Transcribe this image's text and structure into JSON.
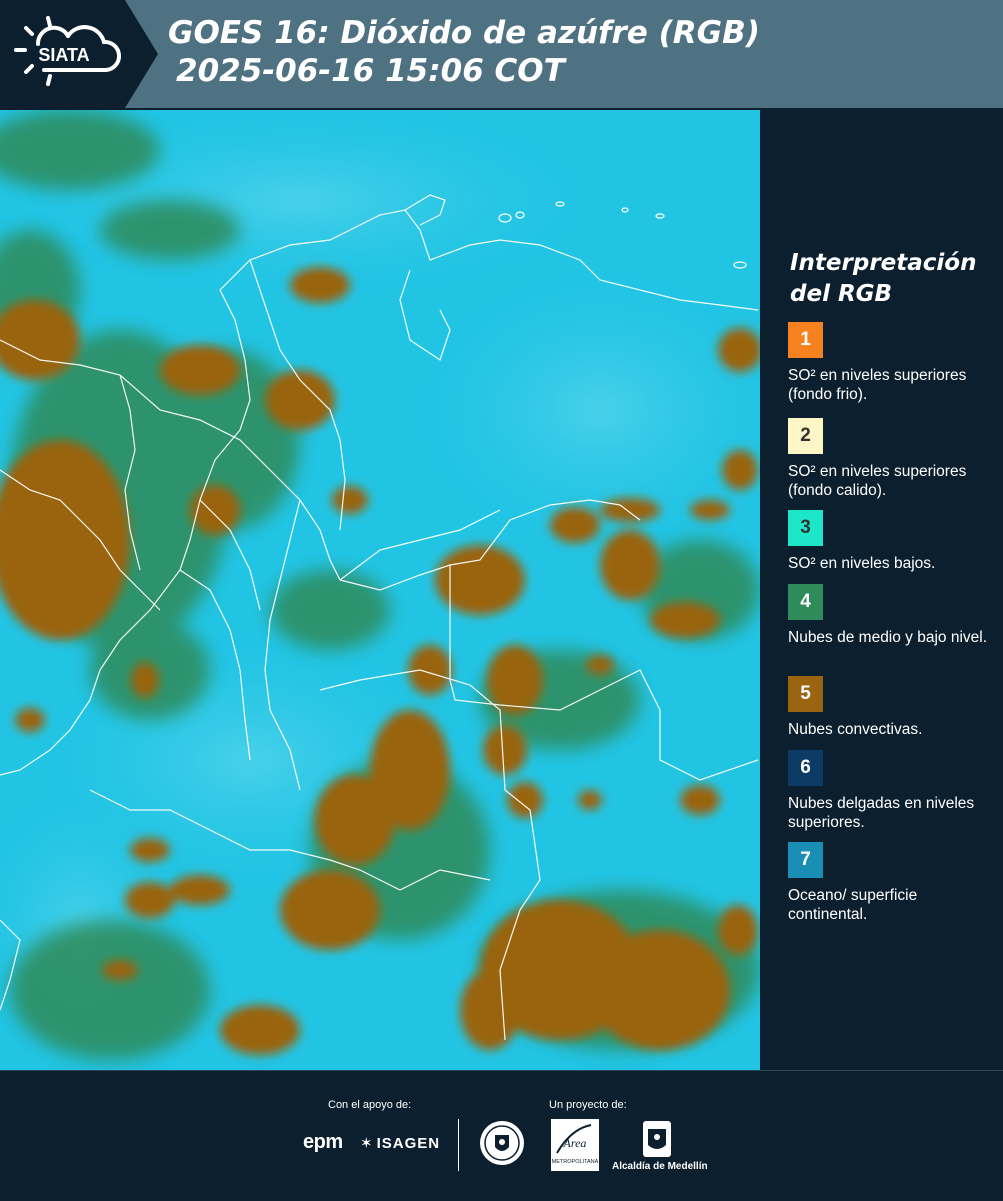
{
  "header": {
    "logo_text": "SIATA",
    "title_line1": "GOES 16: Dióxido de azúfre (RGB)",
    "title_line2": "2025-06-16 15:06 COT"
  },
  "legend": {
    "title": "Interpretación del RGB",
    "items": [
      {
        "number": "1",
        "color": "#f5821f",
        "description": "SO² en niveles superiores (fondo frio)."
      },
      {
        "number": "2",
        "color": "#fff6c8",
        "description": "SO² en niveles superiores (fondo calido)."
      },
      {
        "number": "3",
        "color": "#1ee6c8",
        "description": "SO² en niveles bajos."
      },
      {
        "number": "4",
        "color": "#2e8b5a",
        "description": "Nubes de medio y bajo nivel."
      },
      {
        "number": "5",
        "color": "#9a6410",
        "description": "Nubes convectivas."
      },
      {
        "number": "6",
        "color": "#0e3a66",
        "description": "Nubes delgadas en niveles superiores."
      },
      {
        "number": "7",
        "color": "#1a8fb5",
        "description": "Oceano/ superficie continental."
      }
    ]
  },
  "map": {
    "colors": {
      "background": "#22c4e4",
      "cloud_low": "#2e8b5a",
      "cloud_convective": "#9a6410",
      "borders": "#ffffff"
    }
  },
  "footer": {
    "support_label": "Con el apoyo de:",
    "project_label": "Un proyecto de:",
    "epm_text": "epm",
    "isagen_text": "ISAGEN",
    "area_text": "Área",
    "area_subtext": "METROPOLITANA",
    "alcaldia_text": "Alcaldía de Medellín"
  }
}
